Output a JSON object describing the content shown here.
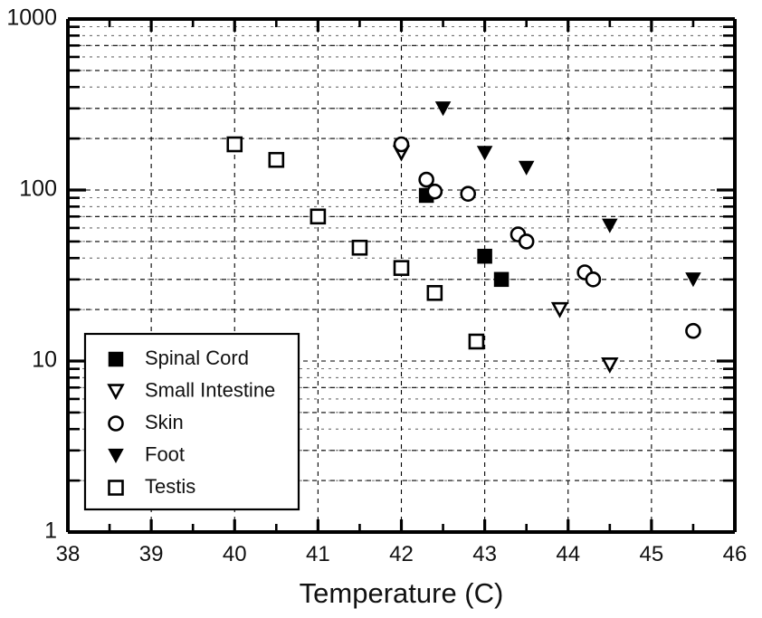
{
  "chart_data": {
    "type": "scatter",
    "title": "",
    "xlabel": "Temperature (C)",
    "ylabel": "",
    "xlim": [
      38,
      46
    ],
    "ylim": [
      1,
      1000
    ],
    "yscale": "log",
    "xscale": "linear",
    "grid": true,
    "legend_position": "lower-left",
    "x_ticks": [
      38,
      39,
      40,
      41,
      42,
      43,
      44,
      45,
      46
    ],
    "x_tick_labels": [
      "38",
      "39",
      "40",
      "41",
      "42",
      "43",
      "44",
      "45",
      "46"
    ],
    "x_minor_ticks": [
      38.5,
      39.5,
      40.5,
      41.5,
      42.5,
      43.5,
      44.5,
      45.5
    ],
    "y_ticks": [
      1,
      10,
      100,
      1000
    ],
    "y_tick_labels": [
      "1",
      "10",
      "100",
      "1000"
    ],
    "series": [
      {
        "name": "Spinal Cord",
        "marker": "filled-square",
        "points": [
          {
            "x": 42.3,
            "y": 93
          },
          {
            "x": 43.0,
            "y": 41
          },
          {
            "x": 43.2,
            "y": 30
          }
        ]
      },
      {
        "name": "Small Intestine",
        "marker": "open-triangle-down",
        "points": [
          {
            "x": 42.0,
            "y": 165
          },
          {
            "x": 43.9,
            "y": 20
          },
          {
            "x": 44.5,
            "y": 9.5
          }
        ]
      },
      {
        "name": "Skin",
        "marker": "open-circle",
        "points": [
          {
            "x": 42.0,
            "y": 185
          },
          {
            "x": 42.3,
            "y": 115
          },
          {
            "x": 42.4,
            "y": 98
          },
          {
            "x": 42.8,
            "y": 95
          },
          {
            "x": 43.4,
            "y": 55
          },
          {
            "x": 43.5,
            "y": 50
          },
          {
            "x": 44.2,
            "y": 33
          },
          {
            "x": 44.3,
            "y": 30
          },
          {
            "x": 45.5,
            "y": 15
          }
        ]
      },
      {
        "name": "Foot",
        "marker": "filled-triangle-down",
        "points": [
          {
            "x": 42.5,
            "y": 300
          },
          {
            "x": 43.0,
            "y": 165
          },
          {
            "x": 43.5,
            "y": 135
          },
          {
            "x": 44.5,
            "y": 62
          },
          {
            "x": 45.5,
            "y": 30
          }
        ]
      },
      {
        "name": "Testis",
        "marker": "open-square",
        "points": [
          {
            "x": 40.0,
            "y": 185
          },
          {
            "x": 40.5,
            "y": 150
          },
          {
            "x": 41.0,
            "y": 70
          },
          {
            "x": 41.5,
            "y": 46
          },
          {
            "x": 42.0,
            "y": 35
          },
          {
            "x": 42.4,
            "y": 25
          },
          {
            "x": 42.9,
            "y": 13
          }
        ]
      }
    ],
    "legend_entries": [
      {
        "label": "Spinal Cord",
        "marker": "filled-square"
      },
      {
        "label": "Small Intestine",
        "marker": "open-triangle-down"
      },
      {
        "label": "Skin",
        "marker": "open-circle"
      },
      {
        "label": "Foot",
        "marker": "filled-triangle-down"
      },
      {
        "label": "Testis",
        "marker": "open-square"
      }
    ],
    "colors": {
      "marker": "#000000",
      "axis": "#000000",
      "grid": "#000000",
      "background": "#ffffff",
      "text": "#111111"
    }
  }
}
